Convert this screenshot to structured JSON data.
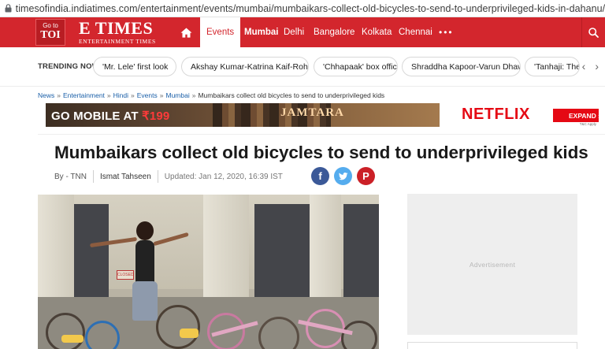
{
  "browser": {
    "url": "timesofindia.indiatimes.com/entertainment/events/mumbai/mumbaikars-collect-old-bicycles-to-send-to-underprivileged-kids-in-dahanu/articleshow/73213225.cms"
  },
  "header": {
    "toi_goto": "Go to",
    "toi_label": "TOI",
    "logo": "E TIMES",
    "logo_tagline": "ENTERTAINMENT TIMES",
    "nav": [
      {
        "label": "Events",
        "active": true
      },
      {
        "label": "Mumbai",
        "sub": true
      },
      {
        "label": "Delhi"
      },
      {
        "label": "Bangalore"
      },
      {
        "label": "Kolkata"
      },
      {
        "label": "Chennai"
      }
    ],
    "more": "•••",
    "brand_color": "#d3262d"
  },
  "trending": {
    "label": "TRENDING NOW:",
    "items": [
      "'Mr. Lele' first look",
      "Akshay Kumar-Katrina Kaif-Rohit Shetty",
      "'Chhapaak' box office",
      "Shraddha Kapoor-Varun Dhawan",
      "'Tanhaji: The"
    ]
  },
  "breadcrumb": {
    "items": [
      "News",
      "Entertainment",
      "Hindi",
      "Events",
      "Mumbai"
    ],
    "current": "Mumbaikars collect old bicycles to send to underprivileged kids",
    "separator": "»"
  },
  "ad_banner": {
    "go_mobile": "GO MOBILE AT",
    "price": "₹199",
    "show": "JAMTARA",
    "brand": "NETFLIX",
    "cta": "EXPAND ›",
    "fine_print": "T&C Apply"
  },
  "article": {
    "title": "Mumbaikars collect old bicycles to send to underprivileged kids",
    "byline": "By - TNN",
    "author": "Ismat Tahseen",
    "updated": "Updated: Jan 12, 2020, 16:39 IST",
    "sign_text": "CLOSED"
  },
  "share": {
    "facebook": "f",
    "twitter": "t",
    "pinterest": "P"
  },
  "sidebar": {
    "ad_label": "Advertisement"
  }
}
